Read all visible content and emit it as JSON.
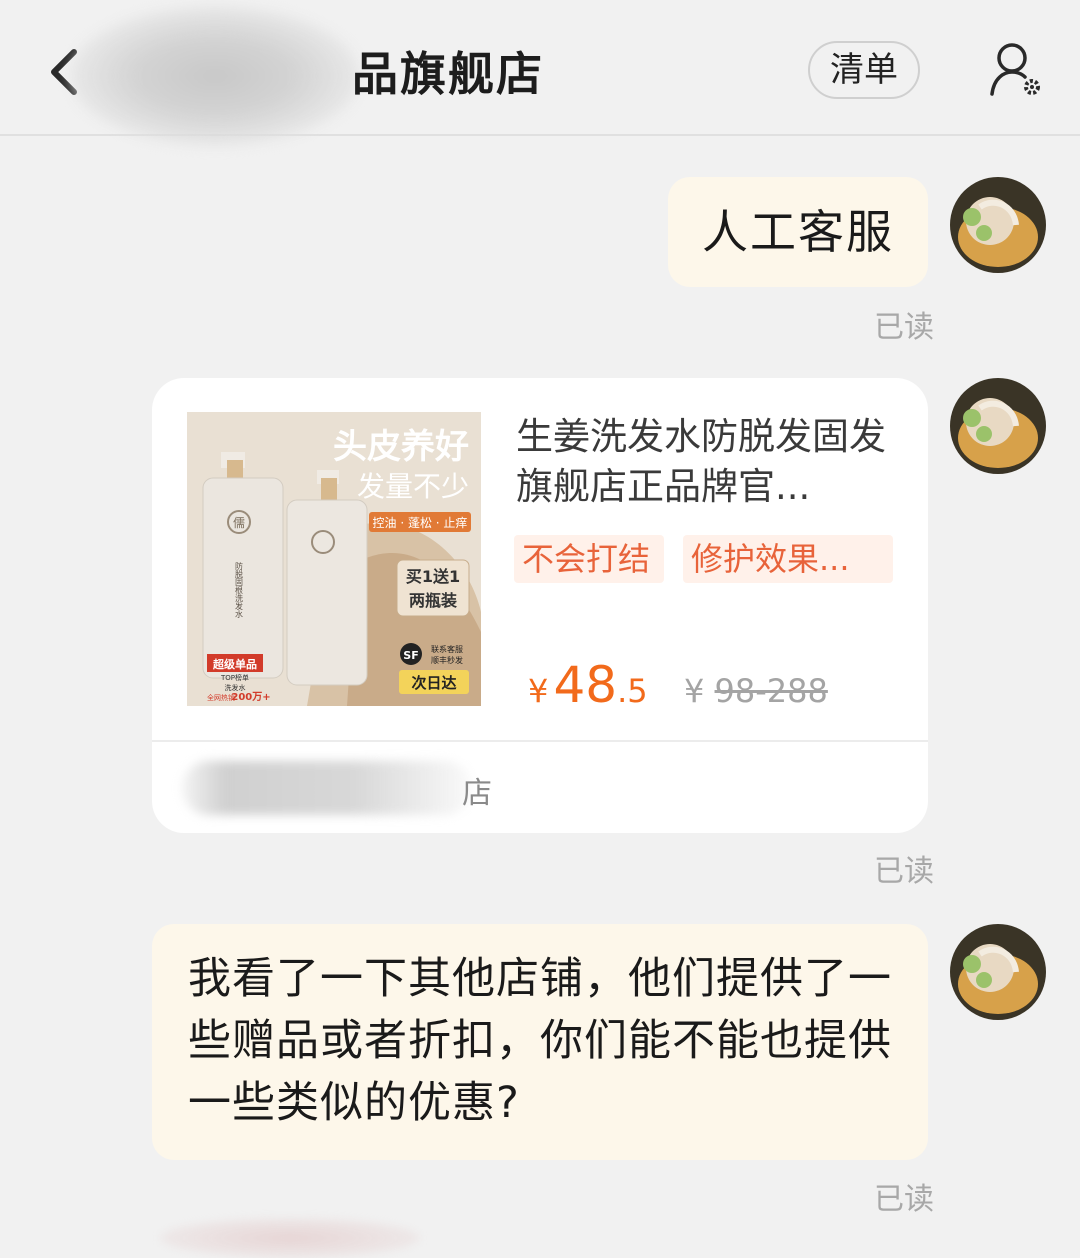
{
  "header": {
    "title": "品旗舰店",
    "list_button": "清单",
    "back_icon": "chevron-left-icon",
    "user_icon": "user-settings-icon"
  },
  "messages": [
    {
      "text": "人工客服",
      "status": "已读"
    },
    {
      "product": {
        "title": "生姜洗发水防脱发固发旗舰店正品牌官...",
        "tags": [
          "不会打结",
          "修护效果..."
        ],
        "price_symbol": "¥",
        "price_int": "48",
        "price_dec": ".5",
        "orig_symbol": "¥",
        "orig_price": "98-288",
        "shop_suffix": "店",
        "image": {
          "headline1": "头皮养好",
          "headline2": "发量不少",
          "benefits": "控油 · 蓬松 · 止痒",
          "promo1": "买1送1",
          "promo2": "两瓶装",
          "delivery": "次日达",
          "sf_logo": "SF",
          "sf_text1": "联系客服",
          "sf_text2": "顺丰秒发",
          "badge1": "超级单品",
          "badge2": "TOP榜单",
          "badge3": "洗发水",
          "badge4": "全网热销",
          "badge5": "200万+",
          "bottle_label": "防脱固根洗发水",
          "bottle_logo": "儒"
        }
      },
      "status": "已读"
    },
    {
      "text": "我看了一下其他店铺，他们提供了一些赠品或者折扣，你们能不能也提供一些类似的优惠?",
      "status": "已读"
    }
  ],
  "colors": {
    "accent": "#f26a1b",
    "bubble": "#fdf7ea",
    "tag_bg": "#fff1ea",
    "tag_fg": "#e8633a"
  }
}
